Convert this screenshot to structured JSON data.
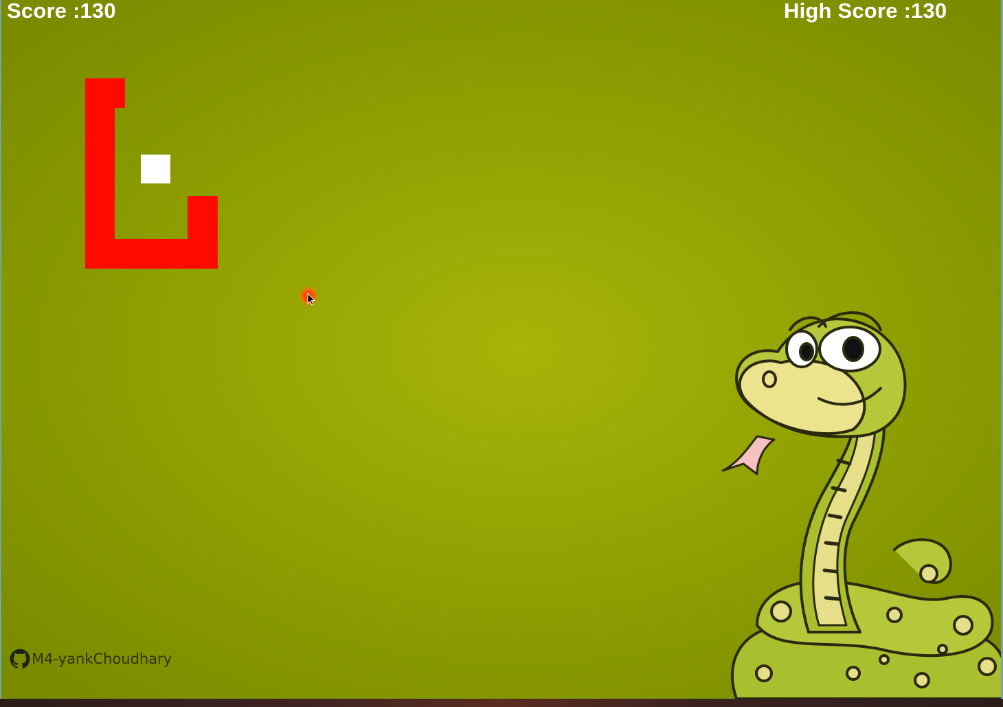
{
  "hud": {
    "score_text": "Score :130",
    "high_score_text": "High Score :130"
  },
  "watermark": {
    "text": "M4-yankChoudhary",
    "icon": "github-icon"
  },
  "mascot": {
    "icon": "cartoon-snake-icon"
  },
  "colors": {
    "background": "#96a504",
    "snake": "#ff0a00",
    "food": "#ffffff",
    "cursor_highlight": "#ff4a00"
  }
}
